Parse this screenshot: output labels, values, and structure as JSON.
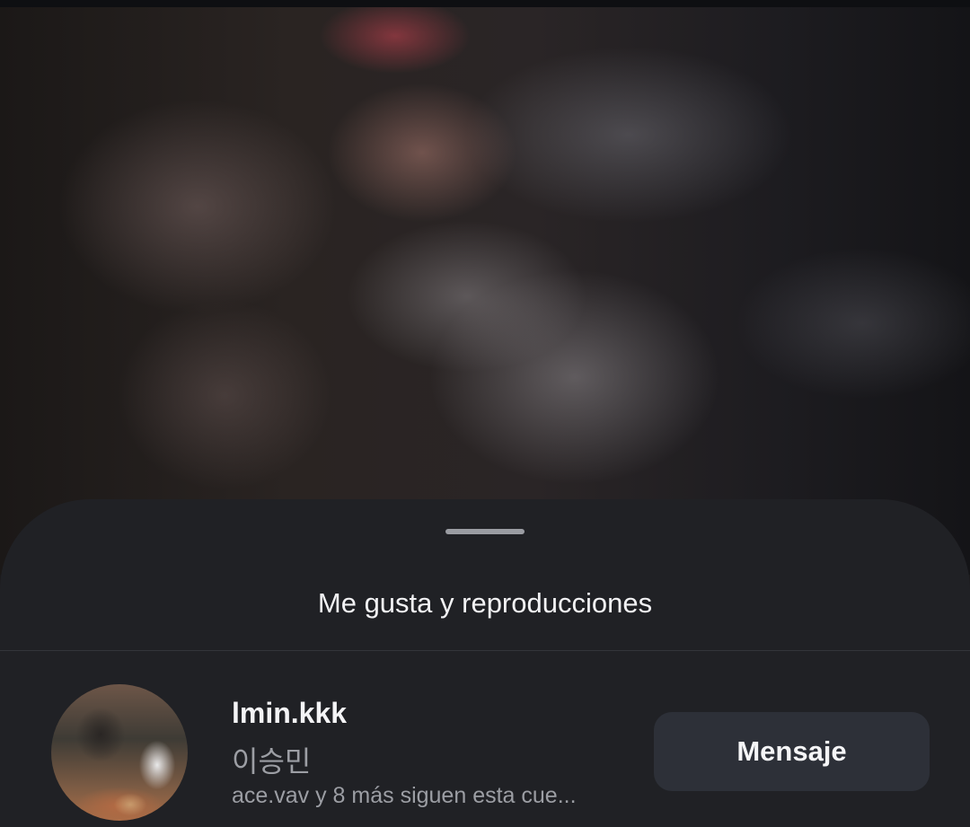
{
  "sheet": {
    "title": "Me gusta y reproducciones"
  },
  "user": {
    "username": "lmin.kkk",
    "full_name": "이승민",
    "followed_by": "ace.vav y 8 más siguen esta cue...",
    "message_button_label": "Mensaje"
  },
  "colors": {
    "sheet_background": "#202125",
    "button_background": "#2d3038",
    "primary_text": "#f4f4f6",
    "secondary_text": "#9c9ea4"
  },
  "icons": {
    "drag_handle": "drag-handle-bar"
  }
}
